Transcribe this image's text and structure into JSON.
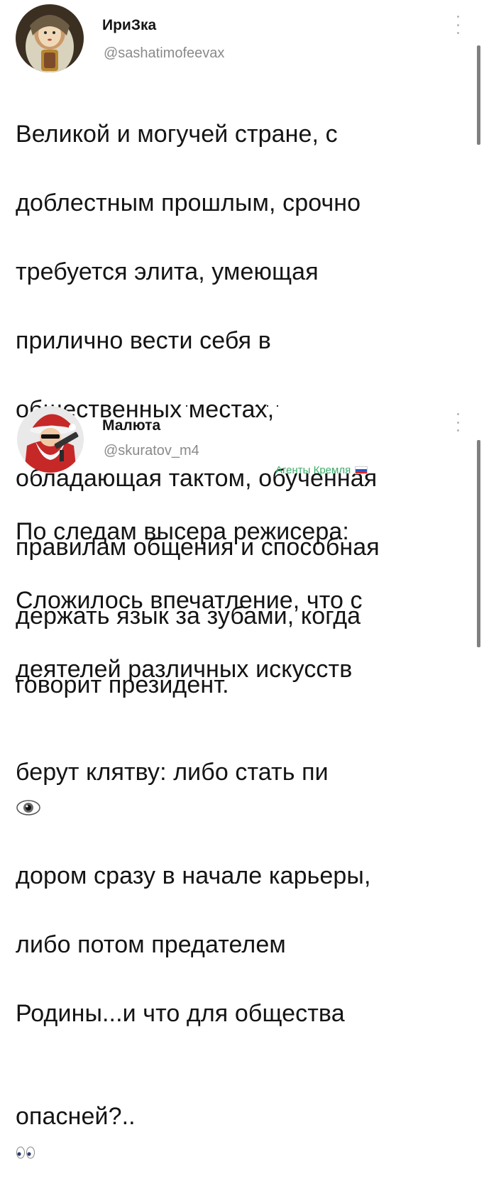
{
  "tweets": [
    {
      "author_name": "ИриЗка",
      "handle": "@sashatimofeevax",
      "avatar_icon": "matryoshka-avatar",
      "text_lines": [
        "Великой и могучей стране, с",
        "доблестным прошлым, срочно",
        "требуется элита, умеющая",
        "прилично вести себя в",
        "общественных местах,",
        "обладающая тактом, обученная",
        "правилам общения и  способная",
        "держать язык за зубами, когда",
        "говорит президент."
      ]
    },
    {
      "author_name": "Малюта",
      "handle": "@skuratov_m4",
      "avatar_icon": "santa-with-gun-avatar",
      "badge_text": "Агенты Кремля",
      "badge_icon": "russian-flag-icon",
      "text_lines_1": [
        "По следам высера режисера:",
        "Сложилось впечатление, что с",
        "деятелей различных искусств"
      ],
      "line_4_before_emoji": "берут клятву: либо стать пи",
      "line_4_emoji": "eye-icon",
      "text_lines_2": [
        "дором сразу в начале карьеры,",
        "либо потом предателем",
        "Родины...и что для общества"
      ],
      "last_line_text": "опасней?..",
      "last_line_emoji": "eyes-icon"
    }
  ],
  "colors": {
    "text": "#141414",
    "handle": "#8a8a8a",
    "badge": "#3fae6a",
    "scrollbar": "#808080"
  }
}
